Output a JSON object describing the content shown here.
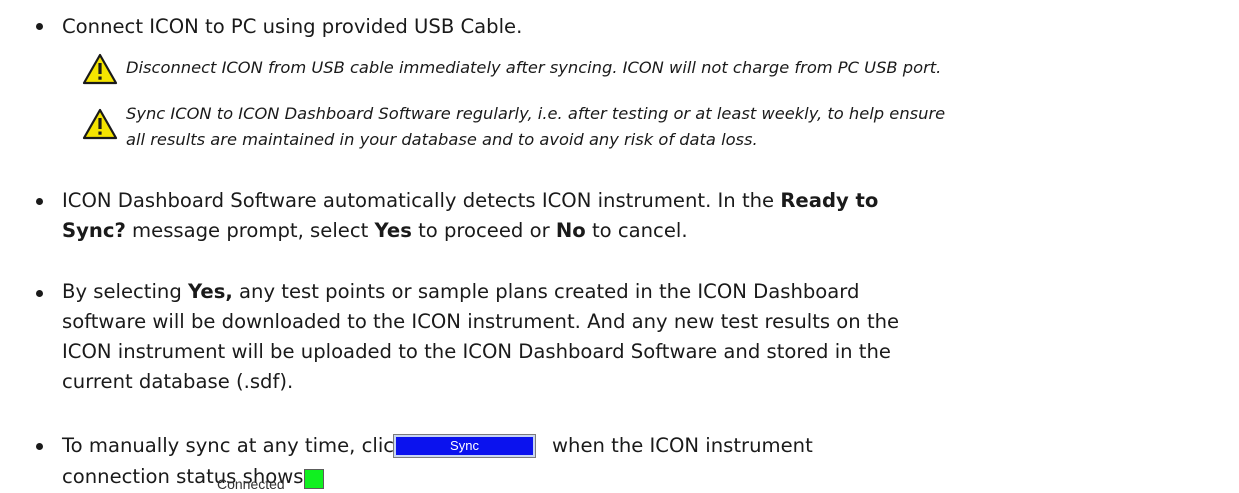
{
  "bullets": [
    {
      "text": "Connect ICON to PC using provided USB Cable."
    },
    {
      "segments": [
        "ICON Dashboard Software automatically detects ICON instrument. In the ",
        "Ready to",
        "Sync?",
        " message prompt, select ",
        "Yes",
        " to proceed or ",
        "No",
        " to cancel."
      ]
    },
    {
      "lead": "By selecting ",
      "bold": "Yes,",
      "lines": [
        " any test points or sample plans created in the ICON Dashboard",
        "software will be downloaded to the ICON instrument. And any new test results on the",
        "ICON instrument will be uploaded to the ICON Dashboard Software and stored in the",
        "current database (.sdf)."
      ]
    },
    {
      "before_button": "To manually sync at any time, click",
      "after_button": "when the ICON instrument",
      "before_status": "connection status shows"
    }
  ],
  "notes": [
    {
      "icon": "warning-triangle",
      "lines": [
        "Disconnect ICON from USB cable immediately after syncing. ICON will not charge from PC USB port."
      ]
    },
    {
      "icon": "warning-triangle",
      "lines": [
        "Sync ICON to ICON Dashboard Software regularly, i.e. after testing or at least weekly, to help ensure",
        "all results are maintained in your database and to avoid any risk of data loss."
      ]
    }
  ],
  "sync_button": {
    "label": "Sync",
    "color": "#0b12ee"
  },
  "connection_status": {
    "label": "Connected",
    "indicator_color": "#10f020"
  },
  "colors": {
    "warning_fill": "#f5e400",
    "warning_stroke": "#1a1a1a"
  }
}
